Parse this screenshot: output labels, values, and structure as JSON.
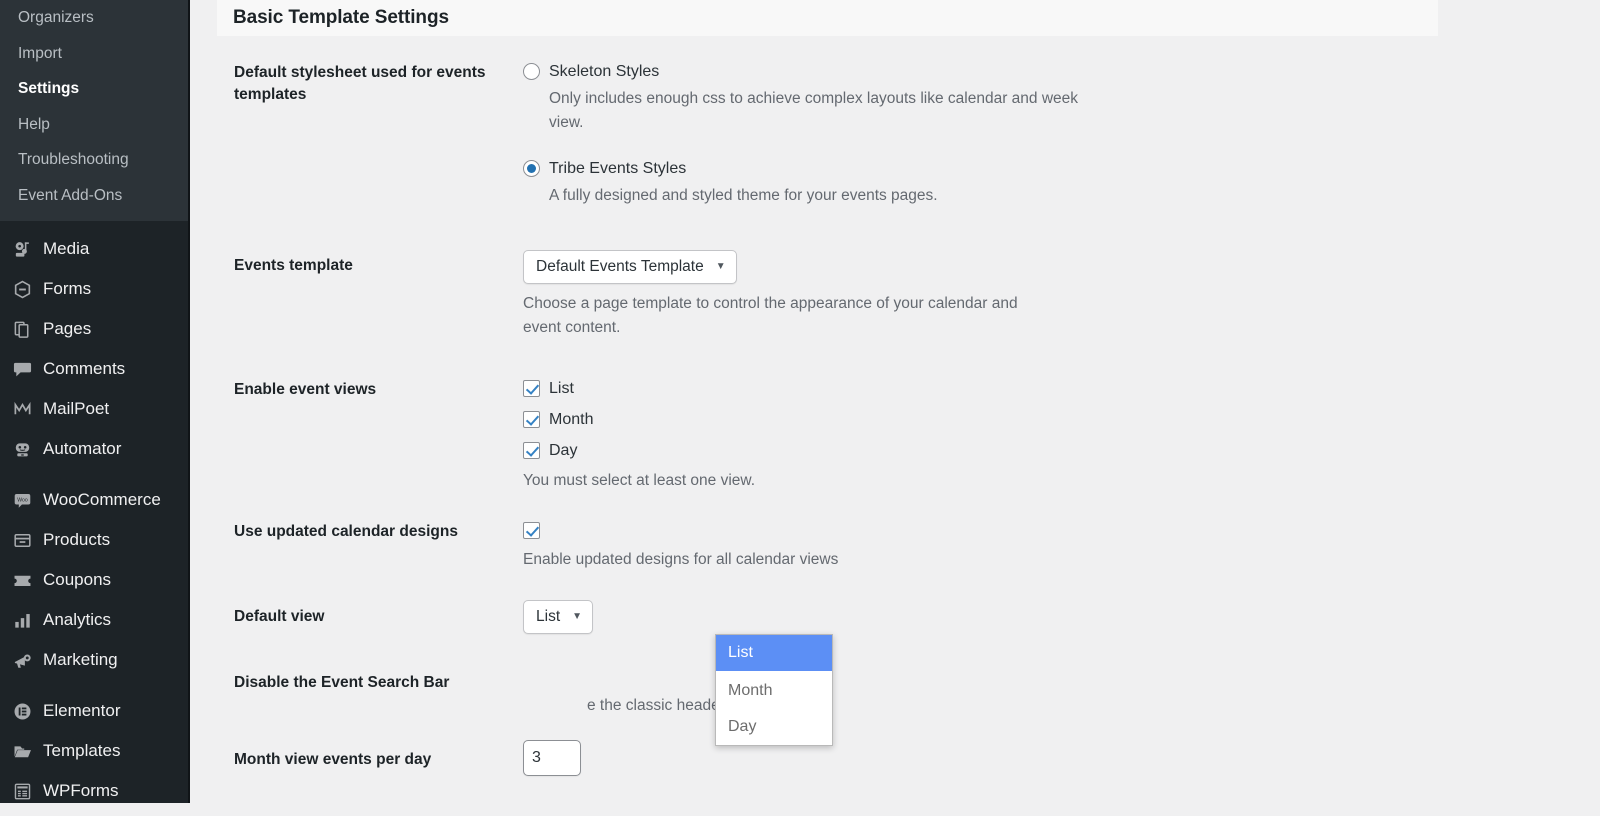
{
  "sidebar": {
    "submenu": {
      "items": [
        {
          "label": "Organizers",
          "current": false
        },
        {
          "label": "Import",
          "current": false
        },
        {
          "label": "Settings",
          "current": true
        },
        {
          "label": "Help",
          "current": false
        },
        {
          "label": "Troubleshooting",
          "current": false
        },
        {
          "label": "Event Add-Ons",
          "current": false
        }
      ]
    },
    "menu": {
      "items": [
        {
          "label": "Media",
          "icon": "media-icon"
        },
        {
          "label": "Forms",
          "icon": "forms-icon"
        },
        {
          "label": "Pages",
          "icon": "pages-icon"
        },
        {
          "label": "Comments",
          "icon": "comments-icon"
        },
        {
          "label": "MailPoet",
          "icon": "mailpoet-icon"
        },
        {
          "label": "Automator",
          "icon": "automator-robot-icon"
        },
        {
          "label": "WooCommerce",
          "icon": "woocommerce-icon"
        },
        {
          "label": "Products",
          "icon": "products-box-icon"
        },
        {
          "label": "Coupons",
          "icon": "coupons-ticket-icon"
        },
        {
          "label": "Analytics",
          "icon": "analytics-bars-icon"
        },
        {
          "label": "Marketing",
          "icon": "marketing-megaphone-icon"
        },
        {
          "label": "Elementor",
          "icon": "elementor-icon"
        },
        {
          "label": "Templates",
          "icon": "templates-folder-icon"
        },
        {
          "label": "WPForms",
          "icon": "wpforms-icon"
        }
      ]
    }
  },
  "panel": {
    "title": "Basic Template Settings"
  },
  "settings": {
    "stylesheet": {
      "label": "Default stylesheet used for events templates",
      "options": [
        {
          "label": "Skeleton Styles",
          "description": "Only includes enough css to achieve complex layouts like calendar and week view.",
          "checked": false
        },
        {
          "label": "Tribe Events Styles",
          "description": "A fully designed and styled theme for your events pages.",
          "checked": true
        }
      ]
    },
    "events_template": {
      "label": "Events template",
      "value": "Default Events Template",
      "description": "Choose a page template to control the appearance of your calendar and event content."
    },
    "enable_event_views": {
      "label": "Enable event views",
      "options": [
        {
          "label": "List",
          "checked": true
        },
        {
          "label": "Month",
          "checked": true
        },
        {
          "label": "Day",
          "checked": true
        }
      ],
      "description": "You must select at least one view."
    },
    "updated_calendar_designs": {
      "label": "Use updated calendar designs",
      "checked": true,
      "description": "Enable updated designs for all calendar views"
    },
    "default_view": {
      "label": "Default view",
      "value": "List",
      "open": true,
      "options": [
        {
          "label": "List",
          "selected": true
        },
        {
          "label": "Month",
          "selected": false
        },
        {
          "label": "Day",
          "selected": false
        }
      ]
    },
    "disable_search_bar": {
      "label": "Disable the Event Search Bar",
      "description_visible_tail": "e the classic header."
    },
    "month_events_per_day": {
      "label": "Month view events per day",
      "value": "3"
    }
  },
  "colors": {
    "sidebar_bg": "#1d2327",
    "submenu_bg": "#2c3338",
    "content_bg": "#f0f0f1",
    "panel_header_bg": "#f8f8f8",
    "accent_blue": "#2271b1",
    "check_blue": "#3582c4",
    "dropdown_highlight": "#5c8ff5",
    "label_text": "#1d2327",
    "desc_text": "#646970"
  },
  "icons": {
    "caret_down": "▼"
  }
}
